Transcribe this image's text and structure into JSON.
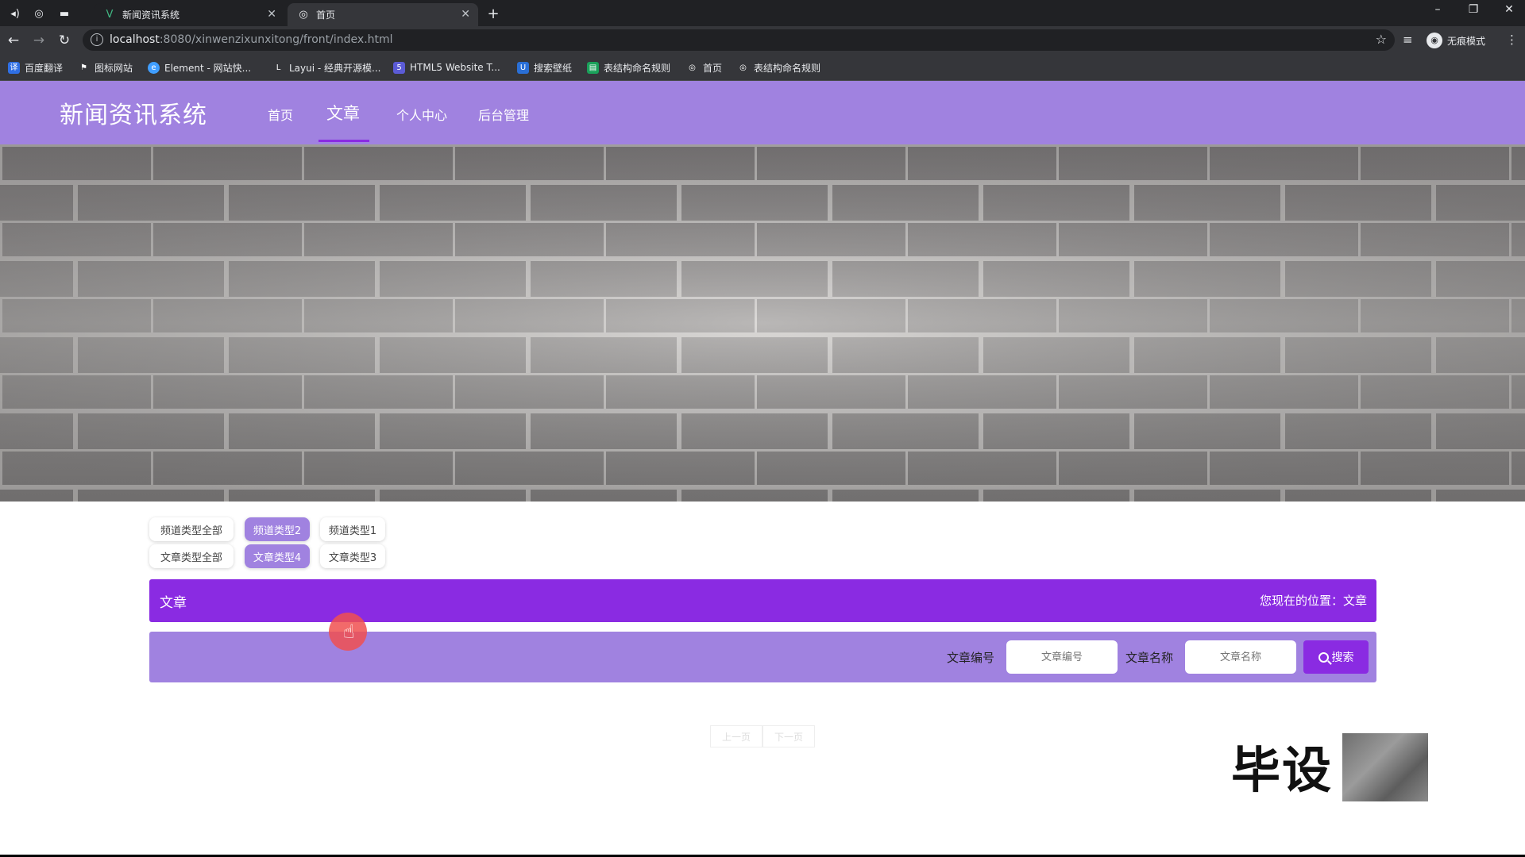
{
  "browser": {
    "tabs": [
      {
        "title": "新闻资讯系统",
        "favicon": "vue-icon",
        "active": false
      },
      {
        "title": "首页",
        "favicon": "globe-icon",
        "active": true
      }
    ],
    "url_host": "localhost",
    "url_rest": ":8080/xinwenzixunxitong/front/index.html",
    "profile_label": "无痕模式",
    "bookmarks": [
      {
        "label": "百度翻译",
        "icon": "translate-icon",
        "color": "#2f6fe4"
      },
      {
        "label": "图标网站",
        "icon": "flag-icon",
        "color": "#35363a"
      },
      {
        "label": "Element - 网站快...",
        "icon": "element-icon",
        "color": "#409eff"
      },
      {
        "label": "Layui - 经典开源模...",
        "icon": "layui-icon",
        "color": "#35363a"
      },
      {
        "label": "HTML5 Website T...",
        "icon": "html5-icon",
        "color": "#5b5bd6"
      },
      {
        "label": "搜索壁纸",
        "icon": "wallpaper-icon",
        "color": "#2a6fd6"
      },
      {
        "label": "表结构命名规则",
        "icon": "doc-icon",
        "color": "#1aa05a"
      },
      {
        "label": "首页",
        "icon": "globe-icon",
        "color": "#35363a"
      },
      {
        "label": "表结构命名规则",
        "icon": "globe-icon",
        "color": "#35363a"
      }
    ]
  },
  "site": {
    "logo": "新闻资讯系统",
    "nav": [
      "首页",
      "文章",
      "个人中心",
      "后台管理"
    ],
    "active_nav": "文章"
  },
  "banner": {
    "slide_count": 3,
    "active_slide": 2
  },
  "filters": {
    "channel": [
      "频道类型全部",
      "频道类型2",
      "频道类型1"
    ],
    "article": [
      "文章类型全部",
      "文章类型4",
      "文章类型3"
    ],
    "selected_index": 1
  },
  "section": {
    "title": "文章",
    "location_label": "您现在的位置：文章"
  },
  "search": {
    "label_id": "文章编号",
    "placeholder_id": "文章编号",
    "label_name": "文章名称",
    "placeholder_name": "文章名称",
    "button": "搜索"
  },
  "pager": {
    "prev": "上一页",
    "next": "下一页"
  },
  "watermark": {
    "text": "毕设"
  },
  "colors": {
    "header": "#a082e0",
    "accent": "#8a2be2"
  }
}
